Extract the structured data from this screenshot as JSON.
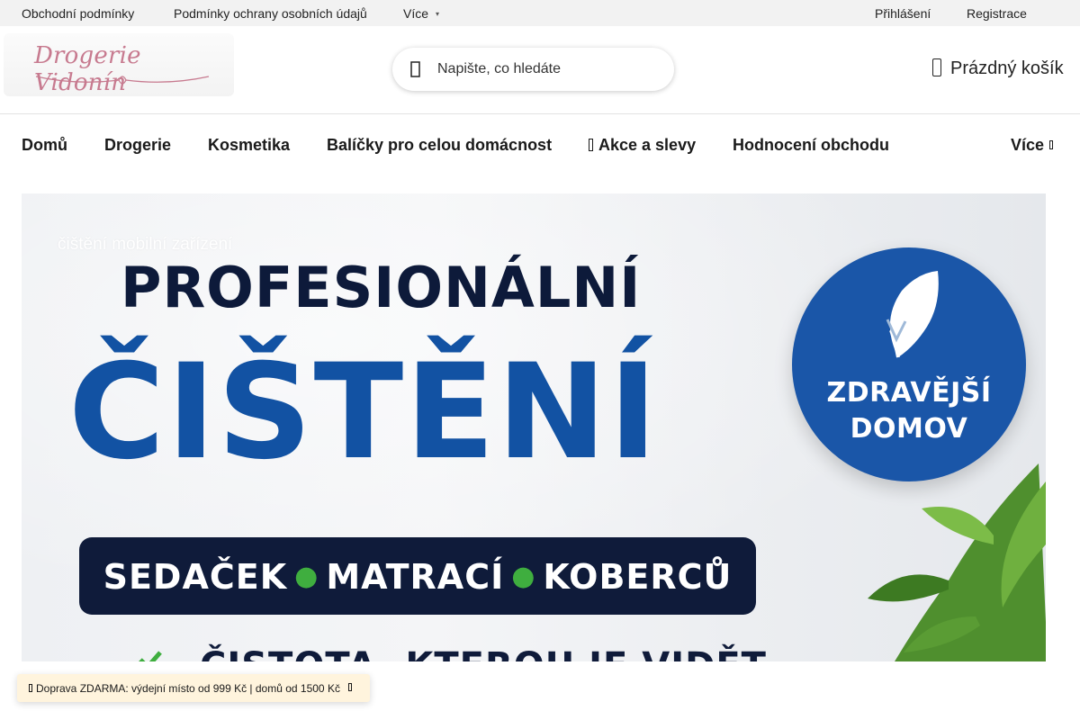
{
  "topbar": {
    "links": [
      "Obchodní podmínky",
      "Podmínky ochrany osobních údajů",
      "Více"
    ],
    "login": "Přihlášení",
    "register": "Registrace"
  },
  "header": {
    "logo_text": "Drogerie Vidonín",
    "search_placeholder": "Napište, co hledáte",
    "cart_label": "Prázdný košík"
  },
  "nav": {
    "items": [
      "Domů",
      "Drogerie",
      "Kosmetika",
      "Balíčky pro celou domácnost",
      "Akce a slevy",
      "Hodnocení obchodu"
    ],
    "more": "Více"
  },
  "banner": {
    "caption": "čištění mobilní zařízení",
    "headline_top": "PROFESIONÁLNÍ",
    "headline_main": "ČIŠTĚNÍ",
    "pill_items": [
      "SEDAČEK",
      "MATRACÍ",
      "KOBERCŮ"
    ],
    "subline": "ČISTOTA, KTEROU JE VIDĚT",
    "badge_lines": [
      "ZDRAVĚJŠÍ",
      "DOMOV"
    ],
    "colors": {
      "navy": "#0f1b3a",
      "blue": "#1252a3",
      "green_dot": "#3fae3f"
    }
  },
  "notice": {
    "text": "Doprava ZDARMA: výdejní místo od 999 Kč | domů od 1500 Kč"
  },
  "icons": {
    "search": "search-icon",
    "cart": "cart-icon",
    "more": "chevron-down-icon",
    "sale": "tag-icon",
    "close": "close-icon"
  }
}
